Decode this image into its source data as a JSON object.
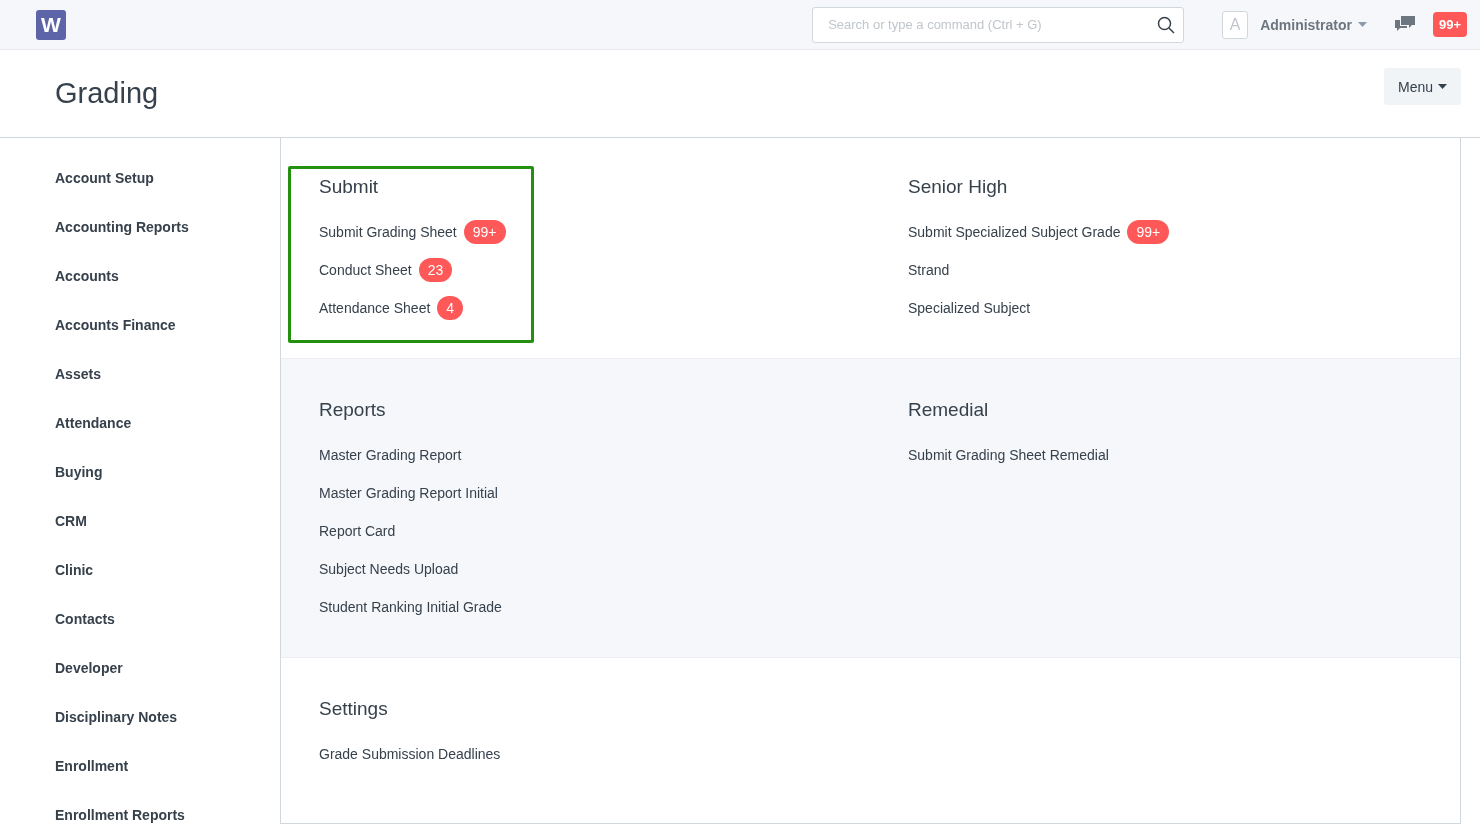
{
  "navbar": {
    "logo": "W",
    "search": {
      "placeholder": "Search or type a command (Ctrl + G)"
    },
    "avatar": "A",
    "user": "Administrator",
    "notifications": "99+"
  },
  "page": {
    "title": "Grading",
    "menu_button": "Menu"
  },
  "sidebar": {
    "items": [
      {
        "label": "Account Setup"
      },
      {
        "label": "Accounting Reports"
      },
      {
        "label": "Accounts"
      },
      {
        "label": "Accounts Finance"
      },
      {
        "label": "Assets"
      },
      {
        "label": "Attendance"
      },
      {
        "label": "Buying"
      },
      {
        "label": "CRM"
      },
      {
        "label": "Clinic"
      },
      {
        "label": "Contacts"
      },
      {
        "label": "Developer"
      },
      {
        "label": "Disciplinary Notes"
      },
      {
        "label": "Enrollment"
      },
      {
        "label": "Enrollment Reports"
      }
    ]
  },
  "rows": [
    {
      "sections": [
        {
          "title": "Submit",
          "highlighted": true,
          "links": [
            {
              "label": "Submit Grading Sheet",
              "count": "99+"
            },
            {
              "label": "Conduct Sheet",
              "count": "23"
            },
            {
              "label": "Attendance Sheet",
              "count": "4"
            }
          ]
        },
        {
          "title": "Senior High",
          "highlighted": false,
          "links": [
            {
              "label": "Submit Specialized Subject Grade",
              "count": "99+"
            },
            {
              "label": "Strand"
            },
            {
              "label": "Specialized Subject"
            }
          ]
        }
      ]
    },
    {
      "sections": [
        {
          "title": "Reports",
          "highlighted": false,
          "links": [
            {
              "label": "Master Grading Report"
            },
            {
              "label": "Master Grading Report Initial"
            },
            {
              "label": "Report Card"
            },
            {
              "label": "Subject Needs Upload"
            },
            {
              "label": "Student Ranking Initial Grade"
            }
          ]
        },
        {
          "title": "Remedial",
          "highlighted": false,
          "links": [
            {
              "label": "Submit Grading Sheet Remedial"
            }
          ]
        }
      ]
    },
    {
      "sections": [
        {
          "title": "Settings",
          "highlighted": false,
          "links": [
            {
              "label": "Grade Submission Deadlines"
            }
          ]
        }
      ]
    }
  ]
}
